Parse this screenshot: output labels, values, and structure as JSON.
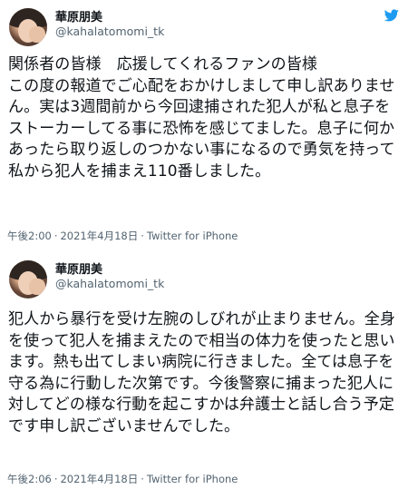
{
  "tweets": [
    {
      "name": "華原朋美",
      "handle": "@kahalatomomi_tk",
      "text": "関係者の皆様　応援してくれるファンの皆様\nこの度の報道でご心配をおかけしまして申し訳ありません。実は3週間前から今回逮捕された犯人が私と息子をストーカーしてる事に恐怖を感じてました。息子に何かあったら取り返しのつかない事になるので勇気を持って私から犯人を捕まえ110番しました。",
      "time": "午後2:00",
      "date": "2021年4月18日",
      "source": "Twitter for iPhone"
    },
    {
      "name": "華原朋美",
      "handle": "@kahalatomomi_tk",
      "text": "犯人から暴行を受け左腕のしびれが止まりません。全身を使って犯人を捕まえたので相当の体力を使ったと思います。熱も出てしまい病院に行きました。全ては息子を守る為に行動した次第です。今後警察に捕まった犯人に対してどの様な行動を起こすかは弁護士と話し合う予定です申し訳ございませんでした。",
      "time": "午後2:06",
      "date": "2021年4月18日",
      "source": "Twitter for iPhone"
    }
  ],
  "icons": {
    "bird": "twitter-bird-icon",
    "avatar": "avatar"
  },
  "colors": {
    "twitter_blue": "#1d9bf0",
    "secondary_text": "#536471",
    "primary_text": "#0f1419"
  },
  "separator_dot": "·"
}
